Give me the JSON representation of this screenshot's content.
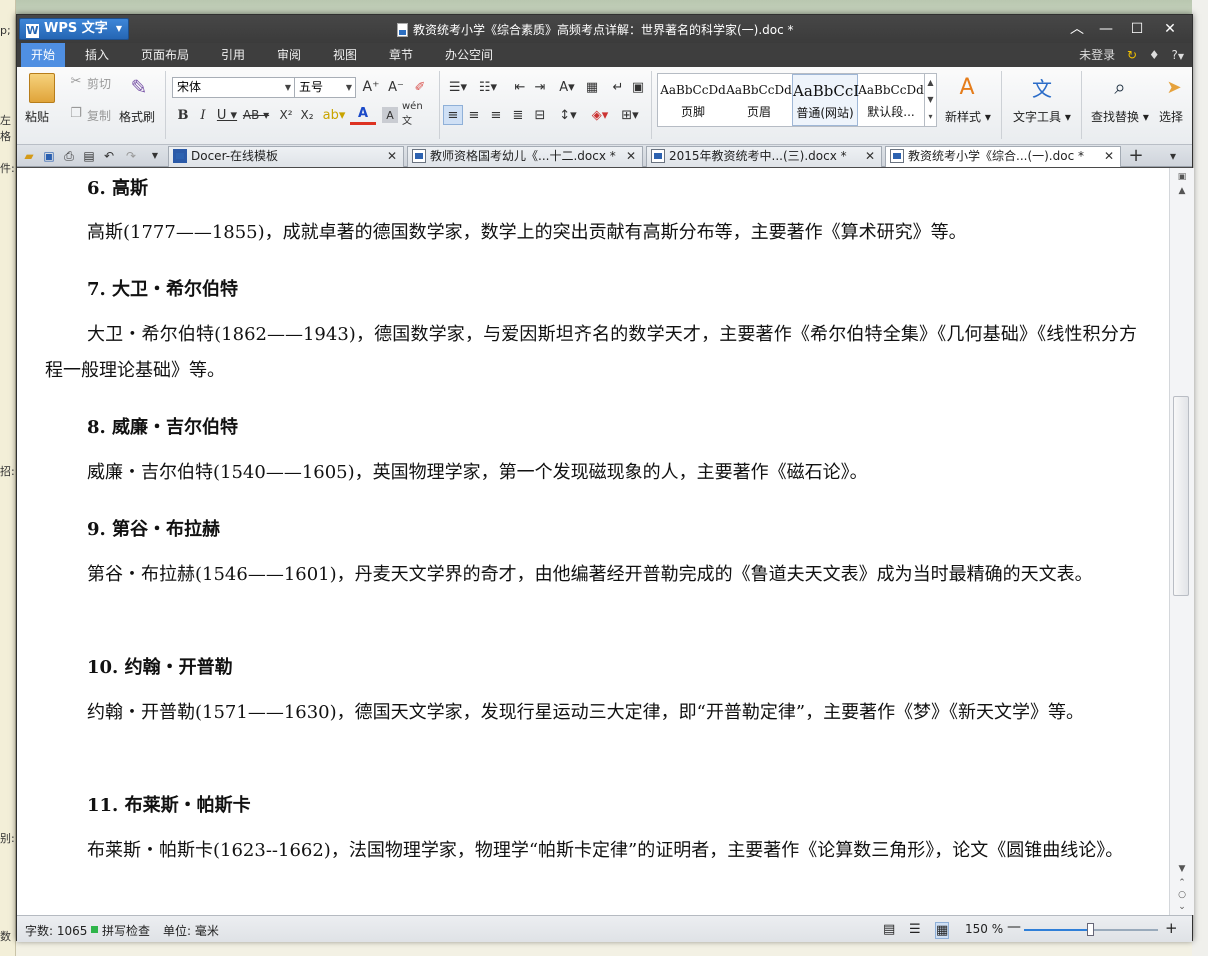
{
  "desktop": {
    "left_labels": [
      "p;",
      "左格",
      "件:",
      "招:",
      "别:",
      "数"
    ]
  },
  "window": {
    "app_button": "WPS 文字",
    "title": "教资统考小学《综合素质》高频考点详解：世界著名的科学家(一).doc *",
    "controls": {
      "collapse": "︿",
      "minimize": "—",
      "maximize": "☐",
      "close": "✕"
    }
  },
  "menus": [
    "开始",
    "插入",
    "页面布局",
    "引用",
    "审阅",
    "视图",
    "章节",
    "办公空间"
  ],
  "menu_right": {
    "login": "未登录",
    "help": "?"
  },
  "ribbon": {
    "paste": "粘贴",
    "cut": "剪切",
    "copy": "复制",
    "format_painter": "格式刷",
    "font_name": "宋体",
    "font_size": "五号",
    "styles": [
      {
        "preview": "AaBbCcDd",
        "name": "页脚"
      },
      {
        "preview": "AaBbCcDd",
        "name": "页眉"
      },
      {
        "preview": "AaBbCcI",
        "name": "普通(网站)"
      },
      {
        "preview": "AaBbCcDd",
        "name": "默认段..."
      }
    ],
    "new_style": "新样式",
    "text_tools": "文字工具",
    "find_replace": "查找替换",
    "select": "选择"
  },
  "tabs": [
    {
      "label": "Docer-在线模板",
      "active": false
    },
    {
      "label": "教师资格国考幼儿《...十二.docx *",
      "active": false
    },
    {
      "label": "2015年教资统考中...(三).docx *",
      "active": false
    },
    {
      "label": "教资统考小学《综合...(一).doc *",
      "active": true
    }
  ],
  "document": {
    "sections": [
      {
        "heading": "6. 高斯",
        "body": "高斯(1777——1855)，成就卓著的德国数学家，数学上的突出贡献有高斯分布等，主要著作《算术研究》等。"
      },
      {
        "heading": "7. 大卫・希尔伯特",
        "body": "大卫・希尔伯特(1862——1943)，德国数学家，与爱因斯坦齐名的数学天才，主要著作《希尔伯特全集》《几何基础》《线性积分方程一般理论基础》等。"
      },
      {
        "heading": "8. 威廉・吉尔伯特",
        "body": "威廉・吉尔伯特(1540——1605)，英国物理学家，第一个发现磁现象的人，主要著作《磁石论》。"
      },
      {
        "heading": "9. 第谷・布拉赫",
        "body": "第谷・布拉赫(1546——1601)，丹麦天文学界的奇才，由他编著经开普勒完成的《鲁道夫天文表》成为当时最精确的天文表。"
      },
      {
        "heading": "10. 约翰・开普勒",
        "body": "约翰・开普勒(1571——1630)，德国天文学家，发现行星运动三大定律，即“开普勒定律”，主要著作《梦》《新天文学》等。"
      },
      {
        "heading": "11. 布莱斯・帕斯卡",
        "body": "布莱斯・帕斯卡(1623--1662)，法国物理学家，物理学“帕斯卡定律”的证明者，主要著作《论算数三角形》，论文《圆锥曲线论》。"
      }
    ]
  },
  "status": {
    "word_count": "字数: 1065",
    "spell_check": "拼写检查",
    "unit": "单位: 毫米",
    "zoom": "150 %",
    "zoom_level": 0.5
  }
}
